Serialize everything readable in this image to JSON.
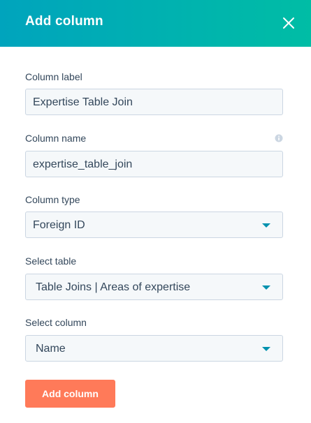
{
  "header": {
    "title": "Add column",
    "close_icon": "close-icon"
  },
  "colors": {
    "header_gradient_start": "#00a4bd",
    "header_gradient_end": "#00bda5",
    "primary_button": "#ff7a59",
    "caret": "#0091ae",
    "input_background": "#f5f8fa",
    "input_border": "#cbd6e2"
  },
  "form": {
    "column_label": {
      "label": "Column label",
      "value": "Expertise Table Join"
    },
    "column_name": {
      "label": "Column name",
      "value": "expertise_table_join",
      "info_icon": "info-icon"
    },
    "column_type": {
      "label": "Column type",
      "selected": "Foreign ID"
    },
    "select_table": {
      "label": "Select table",
      "selected": "Table Joins | Areas of expertise"
    },
    "select_column": {
      "label": "Select column",
      "selected": "Name"
    }
  },
  "actions": {
    "submit_label": "Add column"
  }
}
